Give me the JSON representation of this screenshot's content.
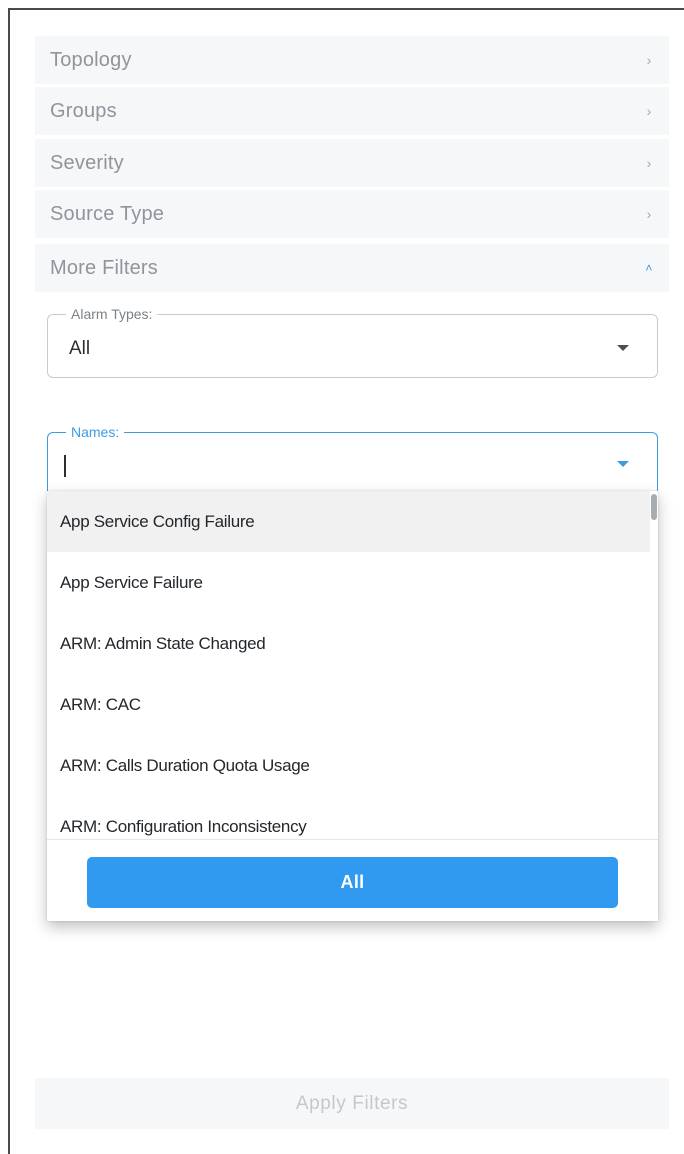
{
  "filters": {
    "sections": [
      {
        "label": "Topology",
        "icon": "chevron-right-icon"
      },
      {
        "label": "Groups",
        "icon": "chevron-right-icon"
      },
      {
        "label": "Severity",
        "icon": "chevron-right-icon"
      },
      {
        "label": "Source Type",
        "icon": "chevron-right-icon"
      },
      {
        "label": "More Filters",
        "icon": "chevron-up-icon",
        "expanded": true
      }
    ],
    "alarm_types": {
      "label": "Alarm Types:",
      "value": "All"
    },
    "names": {
      "label": "Names:",
      "value": "",
      "options": [
        "App Service Config Failure",
        "App Service Failure",
        "ARM: Admin State Changed",
        "ARM: CAC",
        "ARM: Calls Duration Quota Usage",
        "ARM: Configuration Inconsistency"
      ],
      "select_all_label": "All"
    },
    "apply_label": "Apply Filters"
  },
  "colors": {
    "accent": "#2f9af0",
    "row_bg": "#f6f7f9",
    "text_muted": "#8f959c"
  }
}
